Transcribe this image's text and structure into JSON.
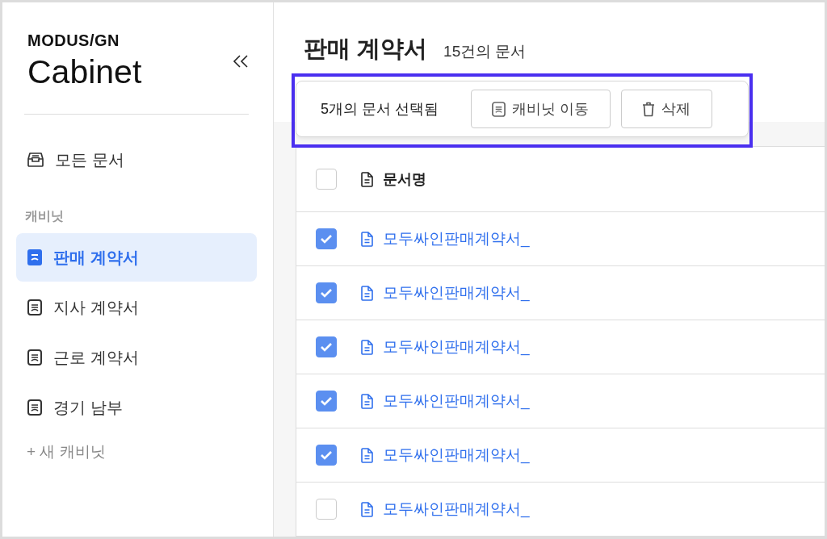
{
  "sidebar": {
    "brand": {
      "company": "MODUS/GN",
      "product": "Cabinet"
    },
    "all_documents": {
      "label": "모든 문서",
      "selected": false
    },
    "section_label": "캐비닛",
    "cabinets": [
      {
        "label": "판매 계약서",
        "selected": true
      },
      {
        "label": "지사 계약서",
        "selected": false
      },
      {
        "label": "근로 계약서",
        "selected": false
      },
      {
        "label": "경기 남부",
        "selected": false
      }
    ],
    "new_cabinet": "+ 새 캐비닛"
  },
  "main": {
    "title": "판매 계약서",
    "count": "15건의 문서",
    "selection_bar": {
      "text": "5개의 문서 선택됨",
      "highlighted": true,
      "buttons": [
        {
          "kind": "move",
          "label": "캐비닛 이동"
        },
        {
          "kind": "delete",
          "label": "삭제"
        }
      ]
    },
    "table": {
      "header_checked": false,
      "columns": [
        "문서명"
      ],
      "rows": [
        {
          "name": "모두싸인판매계약서_",
          "checked": true
        },
        {
          "name": "모두싸인판매계약서_",
          "checked": true
        },
        {
          "name": "모두싸인판매계약서_",
          "checked": true
        },
        {
          "name": "모두싸인판매계약서_",
          "checked": true
        },
        {
          "name": "모두싸인판매계약서_",
          "checked": true
        },
        {
          "name": "모두싸인판매계약서_",
          "checked": false
        }
      ]
    }
  }
}
